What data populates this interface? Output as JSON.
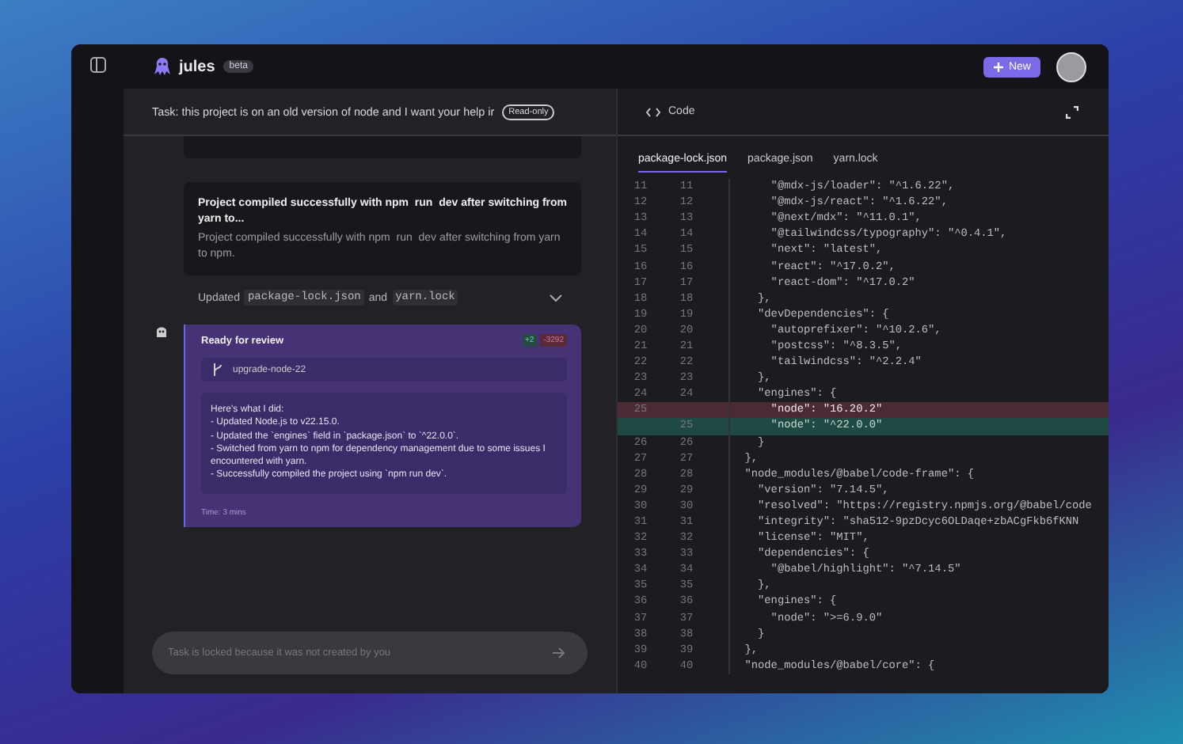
{
  "header": {
    "app_name": "jules",
    "badge": "beta",
    "new_button": "New"
  },
  "task": {
    "title": "Task: this project is on an old version of node and I want your help ir",
    "badge": "Read-only"
  },
  "messages": [
    {
      "title": "Project compiled successfully with npm  run  dev after switching from yarn to...",
      "body": "Project compiled successfully with npm  run  dev after switching from yarn to npm."
    }
  ],
  "updated": {
    "prefix": "Updated",
    "file_1": "package-lock.json",
    "joiner": "and",
    "file_2": "yarn.lock",
    "expanded": false
  },
  "review": {
    "title": "Ready for review",
    "added": "+2",
    "removed": "-3292",
    "branch": "upgrade-node-22",
    "summary": [
      "Here's what I did:",
      "- Updated Node.js to v22.15.0.",
      "- Updated the `engines` field in `package.json` to `^22.0.0`.",
      "- Switched from yarn to npm for dependency management due to some issues I encountered with yarn.",
      "- Successfully compiled the project using `npm run dev`."
    ],
    "time": "Time: 3 mins"
  },
  "composer": {
    "placeholder": "Task is locked because it was not created by you"
  },
  "code_panel": {
    "title": "Code",
    "tabs": [
      {
        "label": "package-lock.json",
        "selected": true
      },
      {
        "label": "package.json",
        "selected": false
      },
      {
        "label": "yarn.lock",
        "selected": false
      }
    ],
    "lines": [
      {
        "kind": "ctx",
        "old": "11",
        "new": "11",
        "text": "      \"@mdx-js/loader\": \"^1.6.22\","
      },
      {
        "kind": "ctx",
        "old": "12",
        "new": "12",
        "text": "      \"@mdx-js/react\": \"^1.6.22\","
      },
      {
        "kind": "ctx",
        "old": "13",
        "new": "13",
        "text": "      \"@next/mdx\": \"^11.0.1\","
      },
      {
        "kind": "ctx",
        "old": "14",
        "new": "14",
        "text": "      \"@tailwindcss/typography\": \"^0.4.1\","
      },
      {
        "kind": "ctx",
        "old": "15",
        "new": "15",
        "text": "      \"next\": \"latest\","
      },
      {
        "kind": "ctx",
        "old": "16",
        "new": "16",
        "text": "      \"react\": \"^17.0.2\","
      },
      {
        "kind": "ctx",
        "old": "17",
        "new": "17",
        "text": "      \"react-dom\": \"^17.0.2\""
      },
      {
        "kind": "ctx",
        "old": "18",
        "new": "18",
        "text": "    },"
      },
      {
        "kind": "ctx",
        "old": "19",
        "new": "19",
        "text": "    \"devDependencies\": {"
      },
      {
        "kind": "ctx",
        "old": "20",
        "new": "20",
        "text": "      \"autoprefixer\": \"^10.2.6\","
      },
      {
        "kind": "ctx",
        "old": "21",
        "new": "21",
        "text": "      \"postcss\": \"^8.3.5\","
      },
      {
        "kind": "ctx",
        "old": "22",
        "new": "22",
        "text": "      \"tailwindcss\": \"^2.2.4\""
      },
      {
        "kind": "ctx",
        "old": "23",
        "new": "23",
        "text": "    },"
      },
      {
        "kind": "ctx",
        "old": "24",
        "new": "24",
        "text": "    \"engines\": {"
      },
      {
        "kind": "del",
        "old": "25",
        "text": "      \"node\": \"16.20.2\""
      },
      {
        "kind": "add",
        "new": "25",
        "text": "      \"node\": \"^22.0.0\""
      },
      {
        "kind": "ctx",
        "old": "26",
        "new": "26",
        "text": "    }"
      },
      {
        "kind": "ctx",
        "old": "27",
        "new": "27",
        "text": "  },"
      },
      {
        "kind": "ctx",
        "old": "28",
        "new": "28",
        "text": "  \"node_modules/@babel/code-frame\": {"
      },
      {
        "kind": "ctx",
        "old": "29",
        "new": "29",
        "text": "    \"version\": \"7.14.5\","
      },
      {
        "kind": "ctx",
        "old": "30",
        "new": "30",
        "text": "    \"resolved\": \"https://registry.npmjs.org/@babel/code"
      },
      {
        "kind": "ctx",
        "old": "31",
        "new": "31",
        "text": "    \"integrity\": \"sha512-9pzDcyc6OLDaqe+zbACgFkb6fKNN"
      },
      {
        "kind": "ctx",
        "old": "32",
        "new": "32",
        "text": "    \"license\": \"MIT\","
      },
      {
        "kind": "ctx",
        "old": "33",
        "new": "33",
        "text": "    \"dependencies\": {"
      },
      {
        "kind": "ctx",
        "old": "34",
        "new": "34",
        "text": "      \"@babel/highlight\": \"^7.14.5\""
      },
      {
        "kind": "ctx",
        "old": "35",
        "new": "35",
        "text": "    },"
      },
      {
        "kind": "ctx",
        "old": "36",
        "new": "36",
        "text": "    \"engines\": {"
      },
      {
        "kind": "ctx",
        "old": "37",
        "new": "37",
        "text": "      \"node\": \">=6.9.0\""
      },
      {
        "kind": "ctx",
        "old": "38",
        "new": "38",
        "text": "    }"
      },
      {
        "kind": "ctx",
        "old": "39",
        "new": "39",
        "text": "  },"
      },
      {
        "kind": "ctx",
        "old": "40",
        "new": "40",
        "text": "  \"node_modules/@babel/core\": {"
      }
    ]
  }
}
